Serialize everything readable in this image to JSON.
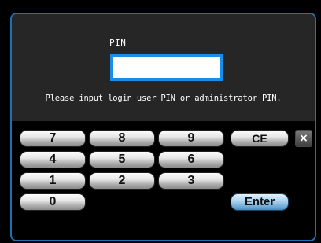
{
  "pin": {
    "label": "PIN",
    "value": ""
  },
  "prompt": "Please input login user PIN or administrator PIN.",
  "keypad": {
    "row1": [
      "7",
      "8",
      "9",
      "CE"
    ],
    "row2": [
      "4",
      "5",
      "6"
    ],
    "row3": [
      "1",
      "2",
      "3"
    ],
    "row4": [
      "0"
    ],
    "enter_label": "Enter",
    "close_icon": "×"
  },
  "colors": {
    "panel_border": "#1f6fb5",
    "input_border": "#1a8de8",
    "enter_key": "#6eaad6"
  }
}
